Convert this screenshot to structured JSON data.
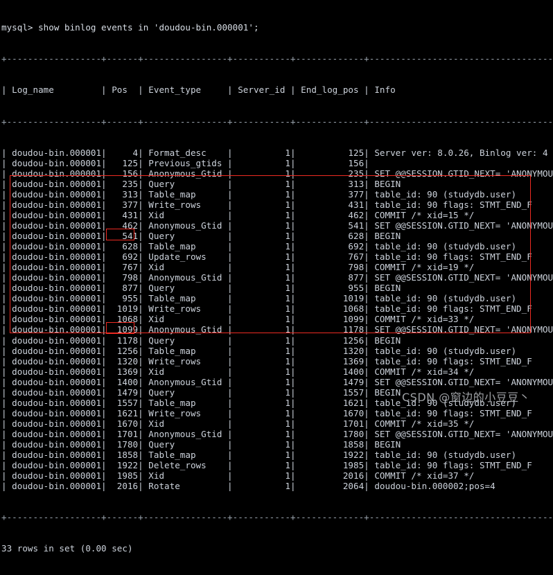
{
  "terminal": {
    "prompt_line": "mysql> show binlog events in 'doudou-bin.000001';",
    "footer_line": "33 rows in set (0.00 sec)",
    "colors": {
      "background": "#000000",
      "text": "#cdd3dc",
      "rule": "#9aa3ad",
      "annotation": "#ef2b23",
      "watermark": "#b9bcc0"
    }
  },
  "table": {
    "separator": "+------------------+------+----------------+-----------+-------------+-----------------------------------------+",
    "columns": [
      "Log_name",
      "Pos",
      "Event_type",
      "Server_id",
      "End_log_pos",
      "Info"
    ],
    "header_row": "| Log_name         | Pos  | Event_type     | Server_id | End_log_pos | Info                                    |",
    "rows": [
      {
        "log_name": "doudou-bin.000001",
        "pos": "4",
        "event_type": "Format_desc",
        "server_id": "1",
        "end_log_pos": "125",
        "info": "Server ver: 8.0.26, Binlog ver: 4"
      },
      {
        "log_name": "doudou-bin.000001",
        "pos": "125",
        "event_type": "Previous_gtids",
        "server_id": "1",
        "end_log_pos": "156",
        "info": ""
      },
      {
        "log_name": "doudou-bin.000001",
        "pos": "156",
        "event_type": "Anonymous_Gtid",
        "server_id": "1",
        "end_log_pos": "235",
        "info": "SET @@SESSION.GTID_NEXT= 'ANONYMOUS'"
      },
      {
        "log_name": "doudou-bin.000001",
        "pos": "235",
        "event_type": "Query",
        "server_id": "1",
        "end_log_pos": "313",
        "info": "BEGIN"
      },
      {
        "log_name": "doudou-bin.000001",
        "pos": "313",
        "event_type": "Table_map",
        "server_id": "1",
        "end_log_pos": "377",
        "info": "table_id: 90 (studydb.user)"
      },
      {
        "log_name": "doudou-bin.000001",
        "pos": "377",
        "event_type": "Write_rows",
        "server_id": "1",
        "end_log_pos": "431",
        "info": "table_id: 90 flags: STMT_END_F"
      },
      {
        "log_name": "doudou-bin.000001",
        "pos": "431",
        "event_type": "Xid",
        "server_id": "1",
        "end_log_pos": "462",
        "info": "COMMIT /* xid=15 */"
      },
      {
        "log_name": "doudou-bin.000001",
        "pos": "462",
        "event_type": "Anonymous_Gtid",
        "server_id": "1",
        "end_log_pos": "541",
        "info": "SET @@SESSION.GTID_NEXT= 'ANONYMOUS'"
      },
      {
        "log_name": "doudou-bin.000001",
        "pos": "541",
        "event_type": "Query",
        "server_id": "1",
        "end_log_pos": "628",
        "info": "BEGIN"
      },
      {
        "log_name": "doudou-bin.000001",
        "pos": "628",
        "event_type": "Table_map",
        "server_id": "1",
        "end_log_pos": "692",
        "info": "table_id: 90 (studydb.user)"
      },
      {
        "log_name": "doudou-bin.000001",
        "pos": "692",
        "event_type": "Update_rows",
        "server_id": "1",
        "end_log_pos": "767",
        "info": "table_id: 90 flags: STMT_END_F"
      },
      {
        "log_name": "doudou-bin.000001",
        "pos": "767",
        "event_type": "Xid",
        "server_id": "1",
        "end_log_pos": "798",
        "info": "COMMIT /* xid=19 */"
      },
      {
        "log_name": "doudou-bin.000001",
        "pos": "798",
        "event_type": "Anonymous_Gtid",
        "server_id": "1",
        "end_log_pos": "877",
        "info": "SET @@SESSION.GTID_NEXT= 'ANONYMOUS'"
      },
      {
        "log_name": "doudou-bin.000001",
        "pos": "877",
        "event_type": "Query",
        "server_id": "1",
        "end_log_pos": "955",
        "info": "BEGIN"
      },
      {
        "log_name": "doudou-bin.000001",
        "pos": "955",
        "event_type": "Table_map",
        "server_id": "1",
        "end_log_pos": "1019",
        "info": "table_id: 90 (studydb.user)"
      },
      {
        "log_name": "doudou-bin.000001",
        "pos": "1019",
        "event_type": "Write_rows",
        "server_id": "1",
        "end_log_pos": "1068",
        "info": "table_id: 90 flags: STMT_END_F"
      },
      {
        "log_name": "doudou-bin.000001",
        "pos": "1068",
        "event_type": "Xid",
        "server_id": "1",
        "end_log_pos": "1099",
        "info": "COMMIT /* xid=33 */"
      },
      {
        "log_name": "doudou-bin.000001",
        "pos": "1099",
        "event_type": "Anonymous_Gtid",
        "server_id": "1",
        "end_log_pos": "1178",
        "info": "SET @@SESSION.GTID_NEXT= 'ANONYMOUS'"
      },
      {
        "log_name": "doudou-bin.000001",
        "pos": "1178",
        "event_type": "Query",
        "server_id": "1",
        "end_log_pos": "1256",
        "info": "BEGIN"
      },
      {
        "log_name": "doudou-bin.000001",
        "pos": "1256",
        "event_type": "Table_map",
        "server_id": "1",
        "end_log_pos": "1320",
        "info": "table_id: 90 (studydb.user)"
      },
      {
        "log_name": "doudou-bin.000001",
        "pos": "1320",
        "event_type": "Write_rows",
        "server_id": "1",
        "end_log_pos": "1369",
        "info": "table_id: 90 flags: STMT_END_F"
      },
      {
        "log_name": "doudou-bin.000001",
        "pos": "1369",
        "event_type": "Xid",
        "server_id": "1",
        "end_log_pos": "1400",
        "info": "COMMIT /* xid=34 */"
      },
      {
        "log_name": "doudou-bin.000001",
        "pos": "1400",
        "event_type": "Anonymous_Gtid",
        "server_id": "1",
        "end_log_pos": "1479",
        "info": "SET @@SESSION.GTID_NEXT= 'ANONYMOUS'"
      },
      {
        "log_name": "doudou-bin.000001",
        "pos": "1479",
        "event_type": "Query",
        "server_id": "1",
        "end_log_pos": "1557",
        "info": "BEGIN"
      },
      {
        "log_name": "doudou-bin.000001",
        "pos": "1557",
        "event_type": "Table_map",
        "server_id": "1",
        "end_log_pos": "1621",
        "info": "table_id: 90 (studydb.user)"
      },
      {
        "log_name": "doudou-bin.000001",
        "pos": "1621",
        "event_type": "Write_rows",
        "server_id": "1",
        "end_log_pos": "1670",
        "info": "table_id: 90 flags: STMT_END_F"
      },
      {
        "log_name": "doudou-bin.000001",
        "pos": "1670",
        "event_type": "Xid",
        "server_id": "1",
        "end_log_pos": "1701",
        "info": "COMMIT /* xid=35 */"
      },
      {
        "log_name": "doudou-bin.000001",
        "pos": "1701",
        "event_type": "Anonymous_Gtid",
        "server_id": "1",
        "end_log_pos": "1780",
        "info": "SET @@SESSION.GTID_NEXT= 'ANONYMOUS'"
      },
      {
        "log_name": "doudou-bin.000001",
        "pos": "1780",
        "event_type": "Query",
        "server_id": "1",
        "end_log_pos": "1858",
        "info": "BEGIN"
      },
      {
        "log_name": "doudou-bin.000001",
        "pos": "1858",
        "event_type": "Table_map",
        "server_id": "1",
        "end_log_pos": "1922",
        "info": "table_id: 90 (studydb.user)"
      },
      {
        "log_name": "doudou-bin.000001",
        "pos": "1922",
        "event_type": "Delete_rows",
        "server_id": "1",
        "end_log_pos": "1985",
        "info": "table_id: 90 flags: STMT_END_F"
      },
      {
        "log_name": "doudou-bin.000001",
        "pos": "1985",
        "event_type": "Xid",
        "server_id": "1",
        "end_log_pos": "2016",
        "info": "COMMIT /* xid=37 */"
      },
      {
        "log_name": "doudou-bin.000001",
        "pos": "2016",
        "event_type": "Rotate",
        "server_id": "1",
        "end_log_pos": "2064",
        "info": "doudou-bin.000002;pos=4"
      }
    ]
  },
  "annotations": {
    "main_box_label": "highlighted-event-block",
    "pos_box_1_label": "1178",
    "pos_box_2_label": "1701"
  },
  "watermark": {
    "text": "CSDN @窗边的小豆豆丶"
  }
}
